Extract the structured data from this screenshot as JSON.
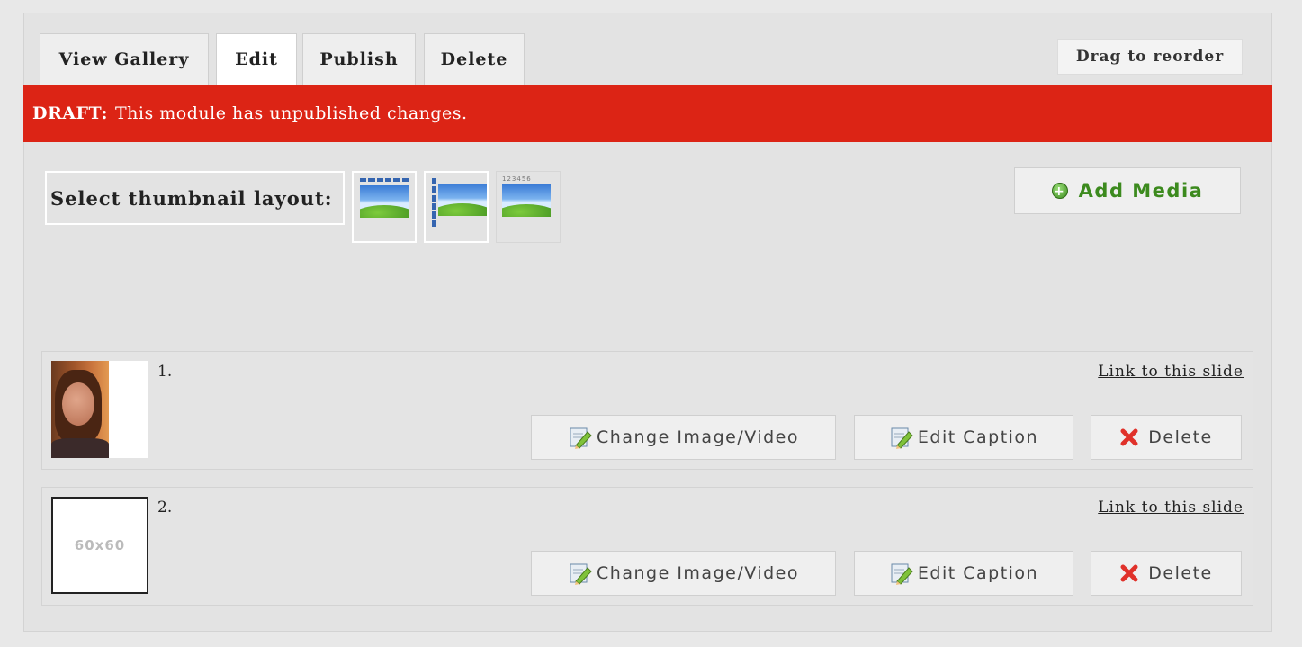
{
  "tabs": [
    {
      "label": "View Gallery"
    },
    {
      "label": "Edit"
    },
    {
      "label": "Publish"
    },
    {
      "label": "Delete"
    }
  ],
  "drag_label": "Drag to reorder",
  "draft": {
    "prefix": "DRAFT:",
    "message": "This module has unpublished changes."
  },
  "layout": {
    "label": "Select thumbnail layout:",
    "numbers_text": "123456"
  },
  "add_media_label": "Add Media",
  "slides": [
    {
      "number": "1.",
      "link_label": "Link to this slide",
      "change_label": "Change Image/Video",
      "caption_label": "Edit Caption",
      "delete_label": "Delete"
    },
    {
      "number": "2.",
      "placeholder_text": "60x60",
      "link_label": "Link to this slide",
      "change_label": "Change Image/Video",
      "caption_label": "Edit Caption",
      "delete_label": "Delete"
    }
  ],
  "colors": {
    "draft_banner": "#dc2415",
    "add_media_text": "#3c8a1e",
    "delete_icon": "#e0312a"
  }
}
